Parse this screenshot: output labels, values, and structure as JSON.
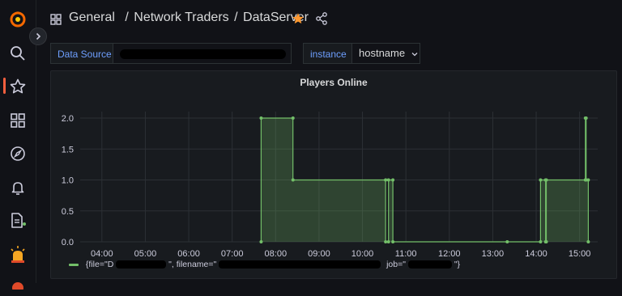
{
  "breadcrumb": {
    "general": "General",
    "separator1": "/",
    "folder": "Network Traders",
    "separator2": "/",
    "dashboard": "DataServer"
  },
  "colors": {
    "accent": "#f55f3e",
    "star": "#ff9830",
    "series": "#73bf69",
    "variable_label": "#6e9fff"
  },
  "variables": {
    "data_source_label": "Data Source",
    "instance_label": "instance",
    "instance_value": "hostname"
  },
  "sidebar": {
    "items": [
      "grafana-logo-icon",
      "search-icon",
      "starred-icon",
      "dashboards-icon",
      "explore-icon",
      "alerting-icon",
      "reports-icon",
      "admin-icon"
    ]
  },
  "panel": {
    "title": "Players Online",
    "legend": {
      "p1": "{file=\"D",
      "p2": "\", filename=\"",
      "p3": "job=\"",
      "p4": "\"}"
    }
  },
  "chart_data": {
    "type": "area",
    "title": "Players Online",
    "ylim": [
      0,
      2
    ],
    "yticks": [
      "0.0",
      "0.5",
      "1.0",
      "1.5",
      "2.0"
    ],
    "xticks": [
      "04:00",
      "05:00",
      "06:00",
      "07:00",
      "08:00",
      "09:00",
      "10:00",
      "11:00",
      "12:00",
      "13:00",
      "14:00",
      "15:00"
    ],
    "grid": true,
    "legend_position": "bottom-left",
    "series": [
      {
        "points": [
          {
            "x": "07:40",
            "y": 0
          },
          {
            "x": "07:40",
            "y": 2
          },
          {
            "x": "08:24",
            "y": 2
          },
          {
            "x": "08:24",
            "y": 1
          },
          {
            "x": "10:32",
            "y": 1
          },
          {
            "x": "10:32",
            "y": 0
          },
          {
            "x": "10:36",
            "y": 0
          },
          {
            "x": "10:36",
            "y": 1
          },
          {
            "x": "10:42",
            "y": 1
          },
          {
            "x": "10:42",
            "y": 0
          },
          {
            "x": "13:20",
            "y": 0
          },
          {
            "x": "14:06",
            "y": 0
          },
          {
            "x": "14:06",
            "y": 1
          },
          {
            "x": "14:13",
            "y": 1
          },
          {
            "x": "14:13",
            "y": 0
          },
          {
            "x": "14:14",
            "y": 0
          },
          {
            "x": "14:14",
            "y": 1
          },
          {
            "x": "15:08",
            "y": 1
          },
          {
            "x": "15:08",
            "y": 2
          },
          {
            "x": "15:09",
            "y": 2
          },
          {
            "x": "15:09",
            "y": 1
          },
          {
            "x": "15:12",
            "y": 1
          },
          {
            "x": "15:12",
            "y": 0
          }
        ]
      }
    ]
  }
}
